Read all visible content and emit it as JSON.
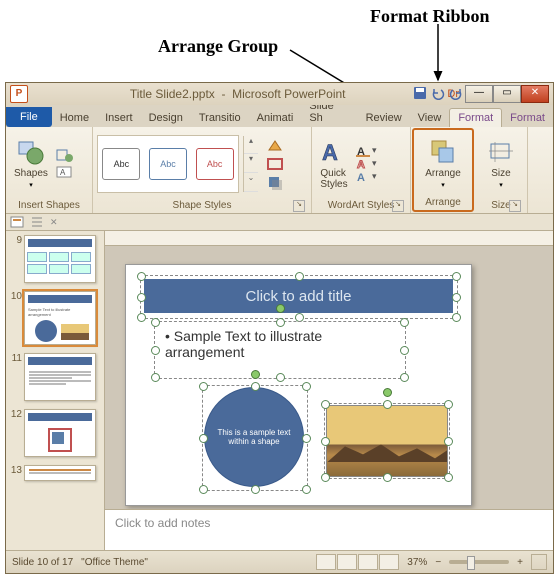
{
  "annotations": {
    "format_ribbon": "Format Ribbon",
    "arrange_group": "Arrange Group"
  },
  "titlebar": {
    "filename": "Title Slide2.pptx",
    "app": "Microsoft PowerPoint",
    "suffix": "Dr"
  },
  "tabs": {
    "file": "File",
    "home": "Home",
    "insert": "Insert",
    "design": "Design",
    "transitions": "Transitio",
    "animations": "Animati",
    "slideshow": "Slide Sh",
    "review": "Review",
    "view": "View",
    "format1": "Format",
    "format2": "Format"
  },
  "ribbon": {
    "insert_shapes": {
      "shapes": "Shapes",
      "group": "Insert Shapes"
    },
    "shape_styles": {
      "swatch": "Abc",
      "group": "Shape Styles"
    },
    "wordart": {
      "quick_styles": "Quick\nStyles",
      "group": "WordArt Styles"
    },
    "arrange": {
      "arrange": "Arrange",
      "group": "Arrange"
    },
    "size": {
      "size": "Size",
      "group": "Size"
    }
  },
  "thumbs": {
    "n9": "9",
    "n10": "10",
    "n11": "11",
    "n12": "12",
    "n13": "13"
  },
  "slide": {
    "title_placeholder": "Click to add title",
    "body_text": "Sample Text to illustrate arrangement",
    "circle_text": "This is a sample text within a shape"
  },
  "notes": {
    "placeholder": "Click to add notes"
  },
  "status": {
    "slide_count": "Slide 10 of 17",
    "theme": "\"Office Theme\"",
    "zoom": "37%"
  }
}
